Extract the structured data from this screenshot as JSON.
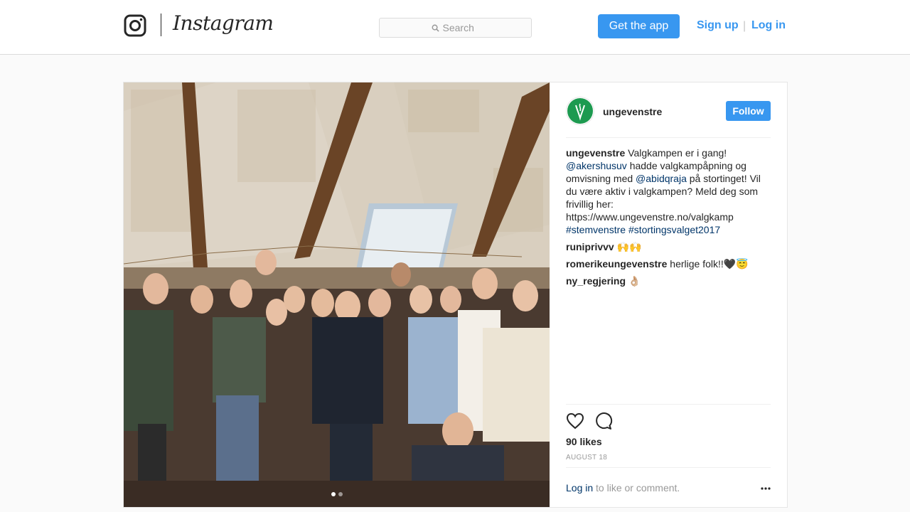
{
  "header": {
    "logo_icon": "instagram-camera-icon",
    "wordmark": "Instagram",
    "search": {
      "placeholder": "Search",
      "icon": "search-icon"
    },
    "get_app_label": "Get the app",
    "signup_label": "Sign up",
    "separator": "|",
    "login_label": "Log in"
  },
  "post": {
    "owner": "ungevenstre",
    "follow_label": "Follow",
    "caption": {
      "user": "ungevenstre",
      "text_1": " Valgkampen er i gang! ",
      "mention_1": "@akershusuv",
      "text_2": " hadde valgkampåpning og omvisning med ",
      "mention_2": "@abidqraja",
      "text_3": " på stortinget! Vil du være aktiv i valgkampen? Meld deg som frivillig her: https://www.ungevenstre.no/valgkamp ",
      "hashtag_1": "#stemvenstre",
      "text_4": " ",
      "hashtag_2": "#stortingsvalget2017"
    },
    "comments": [
      {
        "user": "runiprivvv",
        "text": " 🙌🙌"
      },
      {
        "user": "romerikeungevenstre",
        "text": " herlige folk!!🖤😇"
      },
      {
        "user": "ny_regjering",
        "text": " 👌🏼"
      }
    ],
    "likes": "90 likes",
    "date": "AUGUST 18",
    "footer": {
      "login": "Log in",
      "rest": " to like or comment."
    },
    "carousel": {
      "count": 2,
      "active": 0
    },
    "colors": {
      "accent": "#3897f0",
      "mention": "#003569",
      "avatar_green": "#1d9a50"
    },
    "icons": [
      "heart-icon",
      "comment-icon",
      "more-options-icon"
    ]
  }
}
